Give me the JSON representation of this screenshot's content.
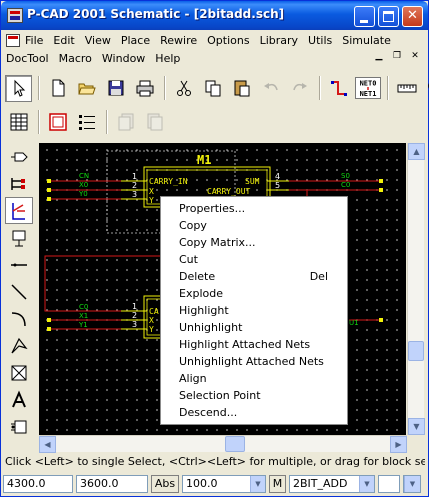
{
  "window": {
    "title": "P-CAD 2001 Schematic - [2bitadd.sch]"
  },
  "menubar": {
    "row1": [
      "File",
      "Edit",
      "View",
      "Place",
      "Rewire",
      "Options",
      "Library",
      "Utils",
      "Simulate"
    ],
    "row2": [
      "DocTool",
      "Macro",
      "Window",
      "Help"
    ]
  },
  "toolbar": {
    "net_label_top": "NET0",
    "net_label_bottom": "NET1"
  },
  "schematic": {
    "ref_top": "M1",
    "pin_labels_top": {
      "carry_in": "CARRY_IN",
      "sum": "SUM",
      "x": "X",
      "carry_out": "CARRY_OUT",
      "y": "Y"
    },
    "pin_numbers_top": [
      "1",
      "2",
      "3",
      "4",
      "5"
    ],
    "nets_top_left": [
      "CN",
      "X0",
      "Y0"
    ],
    "nets_top_right": [
      "S0",
      "C0"
    ],
    "pin_numbers_bottom": [
      "1",
      "2",
      "3"
    ],
    "pin_labels_bottom": [
      "CA",
      "X",
      "Y"
    ],
    "nets_bottom_left": [
      "C0",
      "X1",
      "Y1"
    ],
    "net_bottom_right": "U1"
  },
  "context_menu": {
    "items": [
      {
        "label": "Properties...",
        "shortcut": ""
      },
      {
        "label": "Copy",
        "shortcut": ""
      },
      {
        "label": "Copy Matrix...",
        "shortcut": ""
      },
      {
        "label": "Cut",
        "shortcut": ""
      },
      {
        "label": "Delete",
        "shortcut": "Del"
      },
      {
        "label": "Explode",
        "shortcut": ""
      },
      {
        "label": "Highlight",
        "shortcut": ""
      },
      {
        "label": "Unhighlight",
        "shortcut": ""
      },
      {
        "label": "Highlight Attached Nets",
        "shortcut": ""
      },
      {
        "label": "Unhighlight Attached Nets",
        "shortcut": ""
      },
      {
        "label": "Align",
        "shortcut": ""
      },
      {
        "label": "Selection Point",
        "shortcut": ""
      },
      {
        "label": "Descend...",
        "shortcut": ""
      }
    ]
  },
  "statusbar": {
    "message": "Click <Left> to single Select, <Ctrl><Left> for multiple, or drag for block select.",
    "x_coord": "4300.0",
    "y_coord": "3600.0",
    "abs_label": "Abs",
    "zoom": "100.0",
    "layer_button": "M",
    "layer_name": "2BIT_ADD"
  },
  "colors": {
    "titlebar": "#0a5be0",
    "canvas_bg": "#000000",
    "wire": "#d41818",
    "component": "#f2f20a",
    "net_label": "#10d810",
    "grid_dot": "#9a9a9a"
  }
}
